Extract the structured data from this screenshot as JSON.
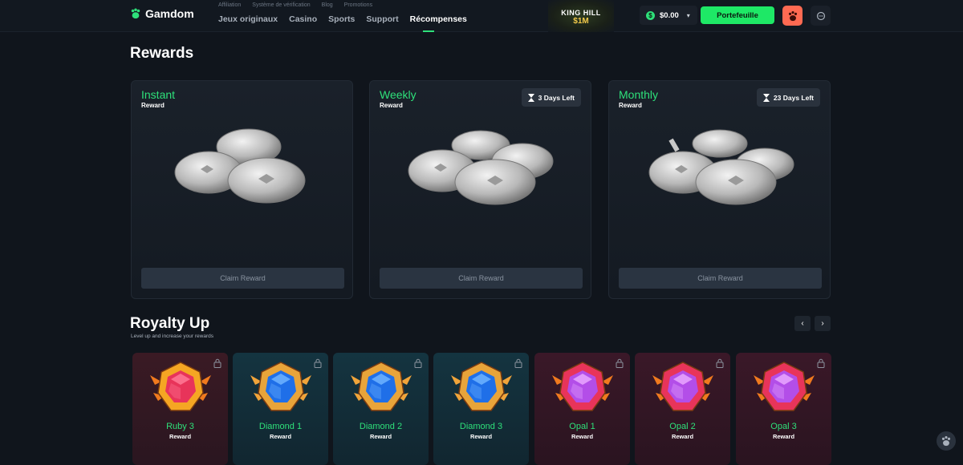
{
  "header": {
    "logo_text": "Gamdom",
    "top_links": [
      "Affiliation",
      "Système de vérification",
      "Blog",
      "Promotions"
    ],
    "main_links": [
      "Jeux originaux",
      "Casino",
      "Sports",
      "Support",
      "Récompenses"
    ],
    "active_link": "Récompenses",
    "promo": {
      "title": "KING HILL",
      "amount": "$1M"
    },
    "balance": "$0.00",
    "wallet_label": "Portefeuille"
  },
  "rewards": {
    "title": "Rewards",
    "cards": [
      {
        "title": "Instant",
        "subtitle": "Reward",
        "timer": "",
        "button": "Claim Reward"
      },
      {
        "title": "Weekly",
        "subtitle": "Reward",
        "timer": "3 Days Left",
        "button": "Claim Reward"
      },
      {
        "title": "Monthly",
        "subtitle": "Reward",
        "timer": "23 Days Left",
        "button": "Claim Reward"
      }
    ]
  },
  "royalty": {
    "title": "Royalty Up",
    "subtitle": "Level up and increase your rewards",
    "prev": "‹",
    "next": "›",
    "tiers": [
      {
        "name": "Ruby 3",
        "reward": "Reward",
        "gem": "ruby"
      },
      {
        "name": "Diamond 1",
        "reward": "Reward",
        "gem": "diamond"
      },
      {
        "name": "Diamond 2",
        "reward": "Reward",
        "gem": "diamond"
      },
      {
        "name": "Diamond 3",
        "reward": "Reward",
        "gem": "diamond"
      },
      {
        "name": "Opal 1",
        "reward": "Reward",
        "gem": "opal"
      },
      {
        "name": "Opal 2",
        "reward": "Reward",
        "gem": "opal"
      },
      {
        "name": "Opal 3",
        "reward": "Reward",
        "gem": "opal"
      }
    ]
  },
  "colors": {
    "accent": "#2ee07a",
    "wallet": "#1ee866",
    "avatar": "#ff6a52",
    "background": "#10151c"
  }
}
